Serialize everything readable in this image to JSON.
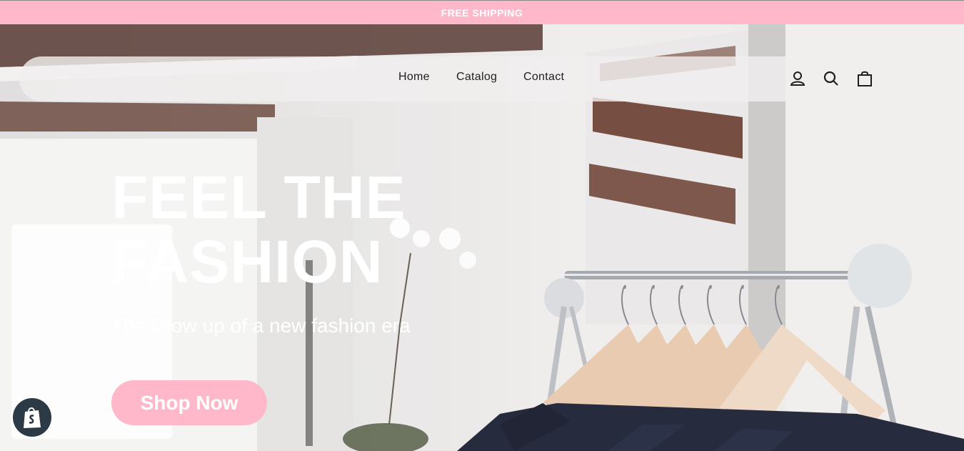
{
  "announcement": {
    "text": "FREE SHIPPING",
    "background": "#ffb8c9"
  },
  "header": {
    "nav": [
      {
        "label": "Home"
      },
      {
        "label": "Catalog"
      },
      {
        "label": "Contact"
      }
    ],
    "icons": [
      "account-icon",
      "search-icon",
      "cart-icon"
    ]
  },
  "hero": {
    "headline_line1": "FEEL THE",
    "headline_line2": "FASHION",
    "subheading": "The Glow up of a new fashion era",
    "cta_label": "Shop Now",
    "cta_color": "#ffb8c9"
  },
  "badge": {
    "icon": "shopify-bag-icon",
    "color": "#2c3a45"
  }
}
